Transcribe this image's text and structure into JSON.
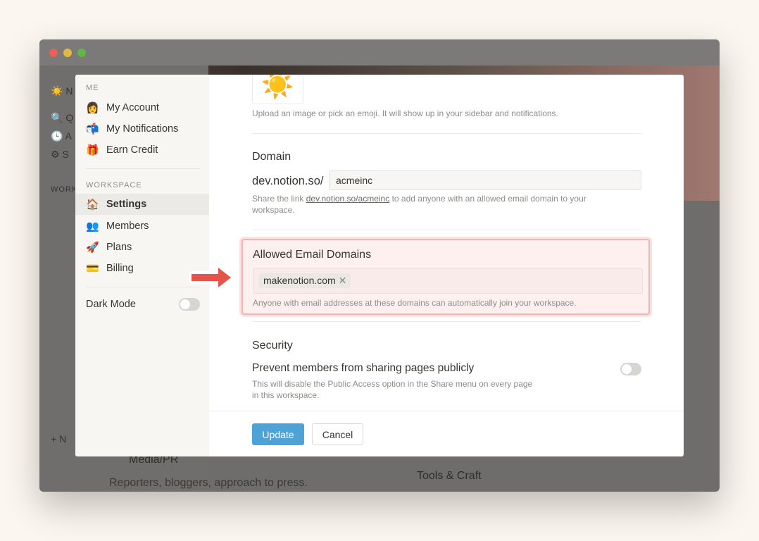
{
  "background": {
    "sidebar_rows": [
      {
        "icon": "☀️",
        "label": "N"
      },
      {
        "icon": "🔍",
        "label": "Q"
      },
      {
        "icon": "🕒",
        "label": "A"
      },
      {
        "icon": "⚙",
        "label": "S"
      }
    ],
    "workspace_label": "WORK",
    "new_label": "N",
    "media_title": "Media/PR",
    "media_desc": "Reporters, bloggers, approach to press.",
    "tools_title": "Tools & Craft"
  },
  "sidebar": {
    "me_label": "ME",
    "me_items": [
      {
        "icon": "👩",
        "label": "My Account"
      },
      {
        "icon": "📬",
        "label": "My Notifications"
      },
      {
        "icon": "🎁",
        "label": "Earn Credit"
      }
    ],
    "workspace_label": "WORKSPACE",
    "workspace_items": [
      {
        "icon": "🏠",
        "label": "Settings"
      },
      {
        "icon": "👥",
        "label": "Members"
      },
      {
        "icon": "🚀",
        "label": "Plans"
      },
      {
        "icon": "💳",
        "label": "Billing"
      }
    ],
    "dark_mode_label": "Dark Mode",
    "dark_mode_on": false
  },
  "settings": {
    "icon_emoji": "☀️",
    "icon_help": "Upload an image or pick an emoji. It will show up in your sidebar and notifications.",
    "domain_title": "Domain",
    "domain_prefix": "dev.notion.so/",
    "domain_value": "acmeinc",
    "domain_help_pre": "Share the link ",
    "domain_help_link": "dev.notion.so/acmeinc",
    "domain_help_post": " to add anyone with an allowed email domain to your workspace.",
    "allowed_title": "Allowed Email Domains",
    "allowed_domains": [
      "makenotion.com"
    ],
    "allowed_help": "Anyone with email addresses at these domains can automatically join your workspace.",
    "security_title": "Security",
    "prevent_label": "Prevent members from sharing pages publicly",
    "prevent_help": "This will disable the Public Access option in the Share menu on every page in this workspace.",
    "prevent_on": false
  },
  "footer": {
    "update_label": "Update",
    "cancel_label": "Cancel"
  },
  "colors": {
    "accent": "#4da3d8",
    "highlight": "#f1b4b4",
    "arrow": "#e5534b"
  }
}
